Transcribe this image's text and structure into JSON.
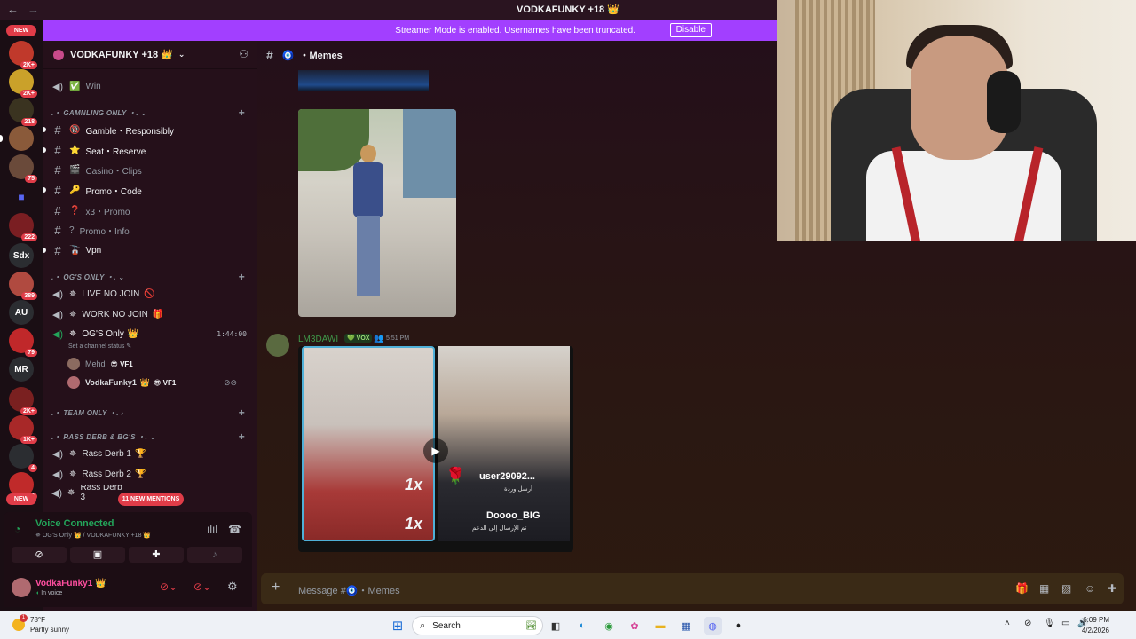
{
  "window": {
    "title": "VODKAFUNKY +18 👑",
    "back": "←",
    "forward": "→"
  },
  "banner": {
    "text": "Streamer Mode is enabled. Usernames have been truncated.",
    "disable_label": "Disable",
    "color": "#a23fff"
  },
  "rail": {
    "new_top": "NEW",
    "new_bottom": "NEW",
    "badges": [
      "2K+",
      "2K+",
      "218",
      "75",
      "222",
      "389",
      "79",
      "2K+",
      "1K+",
      "4",
      "40"
    ],
    "text_servers": [
      "Sdx",
      "AU",
      "MR"
    ]
  },
  "server": {
    "name": "VODKAFUNKY +18 👑"
  },
  "channels": {
    "win": "Win",
    "cat_gambling": "GAMNLING ONLY",
    "gamble": "Gamble・Responsibly",
    "seat": "Seat・Reserve",
    "casino": "Casino・Clips",
    "promo_code": "Promo・Code",
    "x3_promo": "x3・Promo",
    "promo_info": "Promo・Info",
    "vpn": "Vpn",
    "cat_ogs": "OG'S ONLY",
    "live_no_join": "LIVE NO JOIN",
    "work_no_join": "WORK NO JOIN",
    "ogs_only": "OG'S Only",
    "ogs_time": "1:44:00",
    "status_hint": "Set a channel status",
    "voice_user_1": "Mehdi",
    "voice_user_1_tag": "VF1",
    "voice_user_2": "VodkaFunky1",
    "voice_user_2_tag": "VF1",
    "cat_team": "TEAM ONLY",
    "cat_rass": "RASS DERB & BG'S",
    "rass1": "Rass Derb 1",
    "rass2": "Rass Derb 2",
    "rass3": "Rass Derb 3"
  },
  "mentions_pill": "11 NEW MENTIONS",
  "voice_panel": {
    "status": "Voice Connected",
    "location": "OG'S Only 👑 / VODKAFUNKY +18 👑"
  },
  "user_panel": {
    "name": "VodkaFunky1",
    "status": "In voice"
  },
  "chat": {
    "channel_name": "Memes",
    "message": {
      "author": "LM3DAWI",
      "badge": "VOX",
      "time": "5:51 PM"
    },
    "video_overlay": {
      "multiplier_1": "1x",
      "multiplier_2": "1x",
      "gift_user": "user29092...",
      "gift_sub": "أرسل وردة",
      "gift_user_2": "Doooo_BIG",
      "gift_sub_2": "تم الإرسال إلى الدعم"
    },
    "composer_placeholder": "Message #🧿・Memes"
  },
  "taskbar": {
    "temperature": "78°F",
    "weather": "Partly sunny",
    "weather_alert": "1",
    "search_label": "Search",
    "time": "6:09 PM",
    "date": "4/2/2026"
  }
}
